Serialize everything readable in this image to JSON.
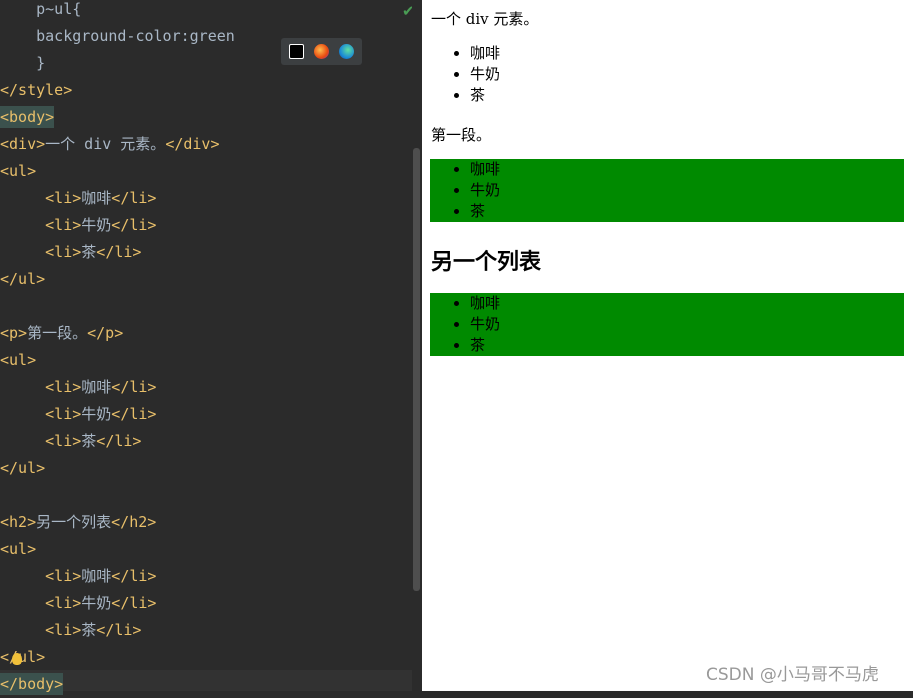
{
  "editor": {
    "lines": [
      {
        "indent": "    ",
        "parts": [
          {
            "cls": "txt",
            "text": "p~ul{"
          }
        ]
      },
      {
        "indent": "    ",
        "parts": [
          {
            "cls": "txt",
            "text": "background-color:green"
          }
        ]
      },
      {
        "indent": "    ",
        "parts": [
          {
            "cls": "txt",
            "text": "}"
          }
        ]
      },
      {
        "indent": "",
        "parts": [
          {
            "cls": "tag",
            "text": "</style>"
          }
        ]
      },
      {
        "indent": "",
        "parts": [
          {
            "cls": "tag hl",
            "text": "<body>"
          }
        ]
      },
      {
        "indent": "",
        "parts": [
          {
            "cls": "tag",
            "text": "<div>"
          },
          {
            "cls": "txt",
            "text": "一个 div 元素。"
          },
          {
            "cls": "tag",
            "text": "</div>"
          }
        ]
      },
      {
        "indent": "",
        "parts": [
          {
            "cls": "tag",
            "text": "<ul>"
          }
        ]
      },
      {
        "indent": "     ",
        "parts": [
          {
            "cls": "tag",
            "text": "<li>"
          },
          {
            "cls": "txt",
            "text": "咖啡"
          },
          {
            "cls": "tag",
            "text": "</li>"
          }
        ]
      },
      {
        "indent": "     ",
        "parts": [
          {
            "cls": "tag",
            "text": "<li>"
          },
          {
            "cls": "txt",
            "text": "牛奶"
          },
          {
            "cls": "tag",
            "text": "</li>"
          }
        ]
      },
      {
        "indent": "     ",
        "parts": [
          {
            "cls": "tag",
            "text": "<li>"
          },
          {
            "cls": "txt",
            "text": "茶"
          },
          {
            "cls": "tag",
            "text": "</li>"
          }
        ]
      },
      {
        "indent": "",
        "parts": [
          {
            "cls": "tag",
            "text": "</ul>"
          }
        ]
      },
      {
        "indent": "",
        "parts": []
      },
      {
        "indent": "",
        "parts": [
          {
            "cls": "tag",
            "text": "<p>"
          },
          {
            "cls": "txt",
            "text": "第一段。"
          },
          {
            "cls": "tag",
            "text": "</p>"
          }
        ]
      },
      {
        "indent": "",
        "parts": [
          {
            "cls": "tag",
            "text": "<ul>"
          }
        ]
      },
      {
        "indent": "     ",
        "parts": [
          {
            "cls": "tag",
            "text": "<li>"
          },
          {
            "cls": "txt",
            "text": "咖啡"
          },
          {
            "cls": "tag",
            "text": "</li>"
          }
        ]
      },
      {
        "indent": "     ",
        "parts": [
          {
            "cls": "tag",
            "text": "<li>"
          },
          {
            "cls": "txt",
            "text": "牛奶"
          },
          {
            "cls": "tag",
            "text": "</li>"
          }
        ]
      },
      {
        "indent": "     ",
        "parts": [
          {
            "cls": "tag",
            "text": "<li>"
          },
          {
            "cls": "txt",
            "text": "茶"
          },
          {
            "cls": "tag",
            "text": "</li>"
          }
        ]
      },
      {
        "indent": "",
        "parts": [
          {
            "cls": "tag",
            "text": "</ul>"
          }
        ]
      },
      {
        "indent": "",
        "parts": []
      },
      {
        "indent": "",
        "parts": [
          {
            "cls": "tag",
            "text": "<h2>"
          },
          {
            "cls": "txt",
            "text": "另一个列表"
          },
          {
            "cls": "tag",
            "text": "</h2>"
          }
        ]
      },
      {
        "indent": "",
        "parts": [
          {
            "cls": "tag",
            "text": "<ul>"
          }
        ]
      },
      {
        "indent": "     ",
        "parts": [
          {
            "cls": "tag",
            "text": "<li>"
          },
          {
            "cls": "txt",
            "text": "咖啡"
          },
          {
            "cls": "tag",
            "text": "</li>"
          }
        ]
      },
      {
        "indent": "     ",
        "parts": [
          {
            "cls": "tag",
            "text": "<li>"
          },
          {
            "cls": "txt",
            "text": "牛奶"
          },
          {
            "cls": "tag",
            "text": "</li>"
          }
        ]
      },
      {
        "indent": "     ",
        "parts": [
          {
            "cls": "tag",
            "text": "<li>"
          },
          {
            "cls": "txt",
            "text": "茶"
          },
          {
            "cls": "tag",
            "text": "</li>"
          }
        ]
      },
      {
        "indent": "",
        "parts": [
          {
            "cls": "tag",
            "text": "</ul>"
          }
        ]
      },
      {
        "indent": "",
        "parts": [
          {
            "cls": "tag hl2",
            "text": "</body>"
          }
        ]
      }
    ],
    "browser_icons": [
      "intellij-icon",
      "firefox-icon",
      "edge-icon"
    ]
  },
  "preview": {
    "div_text": "一个 div 元素。",
    "list1": [
      "咖啡",
      "牛奶",
      "茶"
    ],
    "p_text": "第一段。",
    "list2": [
      "咖啡",
      "牛奶",
      "茶"
    ],
    "h2_text": "另一个列表",
    "list3": [
      "咖啡",
      "牛奶",
      "茶"
    ],
    "green": "#008a00"
  },
  "watermark": "CSDN @小马哥不马虎"
}
